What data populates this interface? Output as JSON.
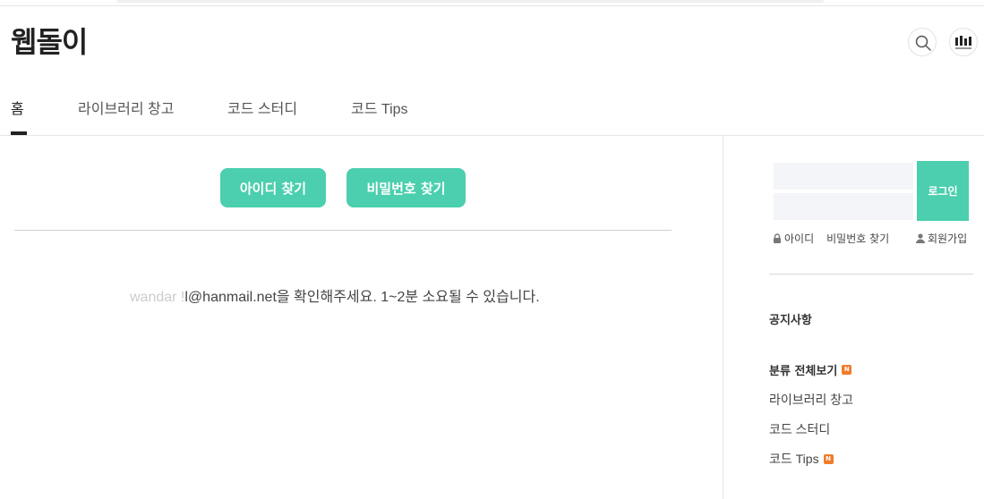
{
  "blog": {
    "title": "웹돌이"
  },
  "header": {
    "search_icon": "search-icon",
    "avatar_icon": "avatar-icon"
  },
  "tabs": [
    {
      "label": "홈",
      "active": true
    },
    {
      "label": "라이브러리 창고",
      "active": false
    },
    {
      "label": "코드 스터디",
      "active": false
    },
    {
      "label": "코드 Tips",
      "active": false
    }
  ],
  "main": {
    "find_id_label": "아이디 찾기",
    "find_pw_label": "비밀번호 찾기",
    "email_masked": "wandar !",
    "message": "l@hanmail.net을 확인해주세요. 1~2분 소요될 수 있습니다."
  },
  "sidebar": {
    "login_label": "로그인",
    "find_id_link": "아이디",
    "find_pw_link": "비밀번호 찾기",
    "join_link": "회원가입",
    "notice_heading": "공지사항",
    "category_all": "분류 전체보기",
    "new_badge": "N",
    "categories": [
      {
        "label": "라이브러리 창고",
        "is_new": false
      },
      {
        "label": "코드 스터디",
        "is_new": false
      },
      {
        "label": "코드 Tips",
        "is_new": true
      }
    ]
  },
  "colors": {
    "accent": "#4bcfae",
    "new_badge": "#ef7c2d"
  }
}
